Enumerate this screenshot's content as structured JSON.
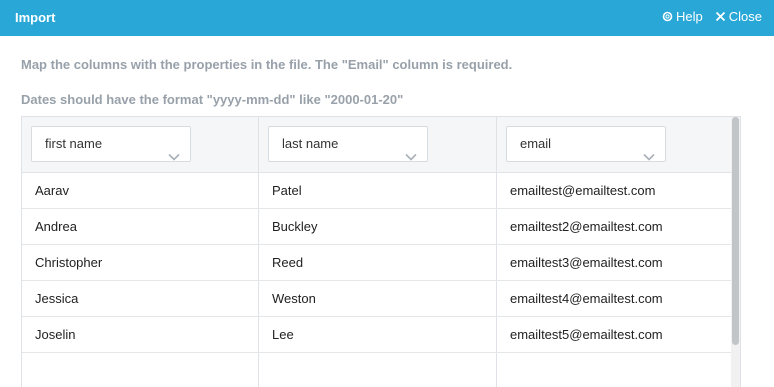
{
  "window": {
    "title": "Import",
    "help_label": "Help",
    "close_label": "Close"
  },
  "instructions": {
    "line1": "Map the columns with the properties in the file. The \"Email\" column is required.",
    "line2": "Dates should have the format \"yyyy-mm-dd\" like \"2000-01-20\""
  },
  "columns": [
    {
      "selected": "first name"
    },
    {
      "selected": "last name"
    },
    {
      "selected": "email"
    }
  ],
  "rows": [
    [
      "Aarav",
      "Patel",
      "emailtest@emailtest.com"
    ],
    [
      "Andrea",
      "Buckley",
      "emailtest2@emailtest.com"
    ],
    [
      "Christopher",
      "Reed",
      "emailtest3@emailtest.com"
    ],
    [
      "Jessica",
      "Weston",
      "emailtest4@emailtest.com"
    ],
    [
      "Joselin",
      "Lee",
      "emailtest5@emailtest.com"
    ]
  ],
  "colors": {
    "titlebar": "#29a8d8",
    "instruction_text": "#98a1aa"
  }
}
